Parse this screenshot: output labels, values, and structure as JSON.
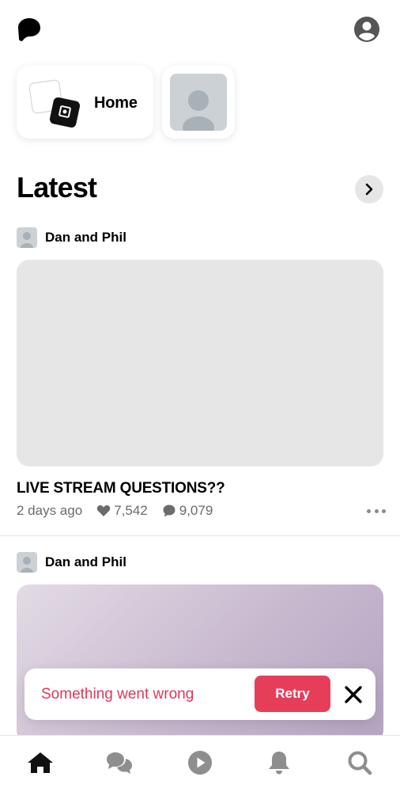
{
  "colors": {
    "accent": "#e63d59",
    "error_text": "#e0365a",
    "placeholder": "#ccd1d6",
    "muted": "#6b6b6b"
  },
  "header": {
    "logo_icon": "patreon-logo-icon",
    "account_icon": "account-circle-icon"
  },
  "creators": {
    "home_label": "Home",
    "items": [
      {
        "avatar": "avatar-placeholder"
      }
    ]
  },
  "section": {
    "title": "Latest",
    "more_icon": "chevron-right-icon"
  },
  "posts": [
    {
      "creator": "Dan and Phil",
      "title": "LIVE STREAM QUESTIONS??",
      "time": "2 days ago",
      "likes": "7,542",
      "comments": "9,079"
    },
    {
      "creator": "Dan and Phil"
    }
  ],
  "toast": {
    "message": "Something went wrong",
    "retry_label": "Retry",
    "close_icon": "close-icon"
  },
  "tabbar": {
    "items": [
      {
        "icon": "home-icon",
        "active": true
      },
      {
        "icon": "chat-icon",
        "active": false
      },
      {
        "icon": "play-icon",
        "active": false
      },
      {
        "icon": "bell-icon",
        "active": false
      },
      {
        "icon": "search-icon",
        "active": false
      }
    ]
  }
}
